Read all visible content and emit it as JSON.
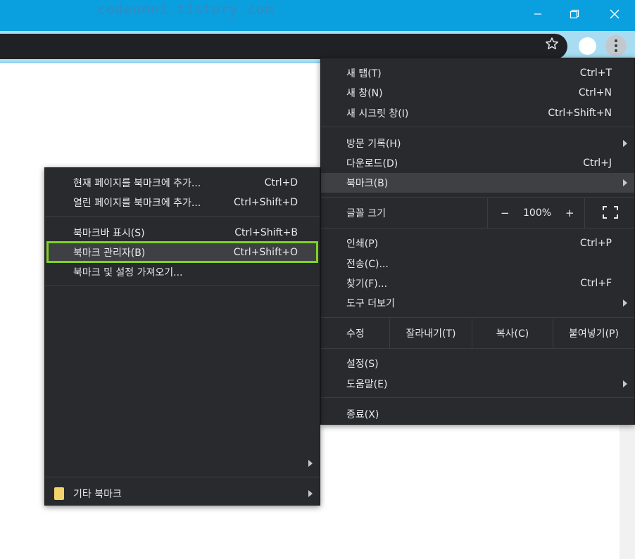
{
  "watermark": "codeomni.tistory.com",
  "window_controls": {
    "minimize": "minimize-icon",
    "maximize": "maximize-icon",
    "close": "close-icon"
  },
  "main_menu": {
    "items_top": [
      {
        "label": "새 탭(T)",
        "shortcut": "Ctrl+T"
      },
      {
        "label": "새 창(N)",
        "shortcut": "Ctrl+N"
      },
      {
        "label": "새 시크릿 창(I)",
        "shortcut": "Ctrl+Shift+N"
      }
    ],
    "items_mid": [
      {
        "label": "방문 기록(H)",
        "has_submenu": true
      },
      {
        "label": "다운로드(D)",
        "shortcut": "Ctrl+J"
      },
      {
        "label": "북마크(B)",
        "has_submenu": true,
        "highlighted": true
      }
    ],
    "zoom": {
      "label": "글꼴 크기",
      "minus": "−",
      "value": "100%",
      "plus": "+"
    },
    "items_tools": [
      {
        "label": "인쇄(P)",
        "shortcut": "Ctrl+P"
      },
      {
        "label": "전송(C)..."
      },
      {
        "label": "찾기(F)...",
        "shortcut": "Ctrl+F"
      },
      {
        "label": "도구 더보기",
        "has_submenu": true
      }
    ],
    "edit": {
      "label": "수정",
      "cut": "잘라내기(T)",
      "copy": "복사(C)",
      "paste": "붙여넣기(P)"
    },
    "items_settings": [
      {
        "label": "설정(S)"
      },
      {
        "label": "도움말(E)",
        "has_submenu": true
      }
    ],
    "exit": {
      "label": "종료(X)"
    }
  },
  "bookmark_menu": {
    "items_top": [
      {
        "label": "현재 페이지를 북마크에 추가...",
        "shortcut": "Ctrl+D"
      },
      {
        "label": "열린 페이지를 북마크에 추가...",
        "shortcut": "Ctrl+Shift+D"
      }
    ],
    "items_mid": [
      {
        "label": "북마크바 표시(S)",
        "shortcut": "Ctrl+Shift+B"
      },
      {
        "label": "북마크 관리자(B)",
        "shortcut": "Ctrl+Shift+O",
        "highlighted": true
      },
      {
        "label": "북마크 및 설정 가져오기..."
      }
    ],
    "other_bookmarks": {
      "label": "기타 북마크",
      "icon": "folder-icon"
    }
  },
  "colors": {
    "titlebar": "#0aa0e0",
    "menu_bg": "#292a2d",
    "highlight_border": "#7ed321",
    "menu_text": "#e8eaed"
  }
}
